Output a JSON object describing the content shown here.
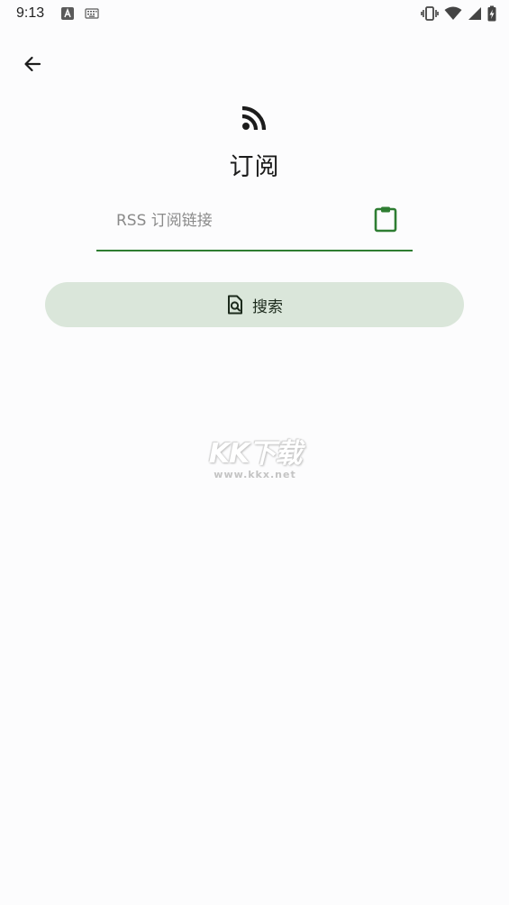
{
  "status_bar": {
    "time": "9:13",
    "left_icons": [
      "font-a-icon",
      "keyboard-icon"
    ],
    "right_icons": [
      "vibrate-icon",
      "wifi-icon",
      "signal-icon",
      "battery-charging-icon"
    ]
  },
  "toolbar": {
    "back_icon": "arrow-back-icon"
  },
  "header": {
    "icon": "rss-feed-icon",
    "title": "订阅"
  },
  "url_field": {
    "placeholder": "RSS 订阅链接",
    "value": "",
    "trailing_icon": "clipboard-paste-icon"
  },
  "search_button": {
    "icon": "document-search-icon",
    "label": "搜索"
  },
  "watermark": {
    "logo": "KK下载",
    "url": "www.kkx.net"
  },
  "colors": {
    "accent": "#2e7d32",
    "button_bg": "#dae6da",
    "background": "#fcfcfd"
  }
}
